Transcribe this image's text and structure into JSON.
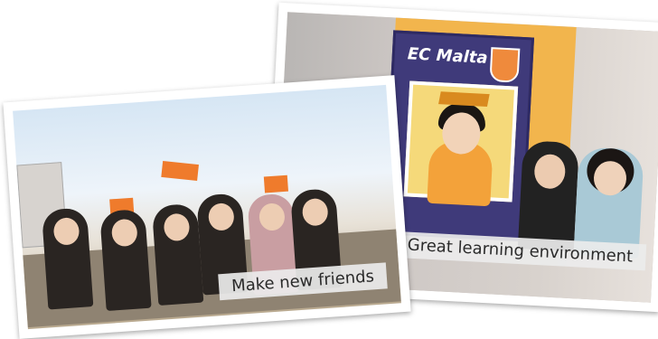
{
  "photos": {
    "right": {
      "sign_text": "EC Malta",
      "caption": "Great learning environment"
    },
    "left": {
      "caption": "Make new friends"
    }
  },
  "colors": {
    "brand_orange": "#ef8a3c",
    "frame_purple": "#3f3a7a",
    "caption_bg": "#ebebeb"
  }
}
